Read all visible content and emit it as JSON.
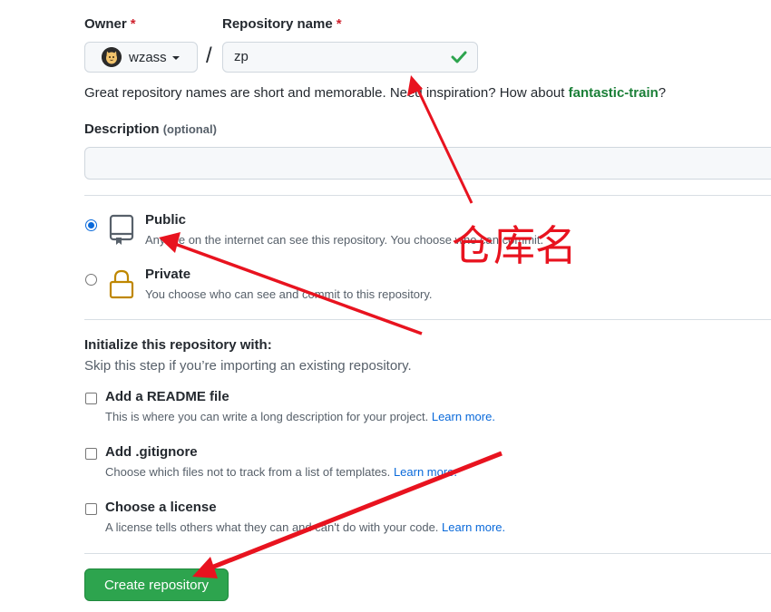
{
  "owner": {
    "label": "Owner",
    "required_mark": "*",
    "name": "wzass"
  },
  "repository": {
    "label": "Repository name",
    "required_mark": "*",
    "separator": "/",
    "value": "zp",
    "hint_prefix": "Great repository names are short and memorable. Need inspiration? How about ",
    "suggestion": "fantastic-train",
    "hint_suffix": "?"
  },
  "description": {
    "label": "Description",
    "optional": "(optional)",
    "value": ""
  },
  "visibility": {
    "options": [
      {
        "title": "Public",
        "subtitle": "Anyone on the internet can see this repository. You choose who can commit.",
        "selected": true,
        "icon": "repo-icon"
      },
      {
        "title": "Private",
        "subtitle": "You choose who can see and commit to this repository.",
        "selected": false,
        "icon": "lock-icon"
      }
    ]
  },
  "initialize": {
    "title": "Initialize this repository with:",
    "subtitle": "Skip this step if you’re importing an existing repository.",
    "items": [
      {
        "title": "Add a README file",
        "subtitle": "This is where you can write a long description for your project.",
        "link": "Learn more.",
        "checked": false
      },
      {
        "title": "Add .gitignore",
        "subtitle": "Choose which files not to track from a list of templates.",
        "link": "Learn more.",
        "checked": false
      },
      {
        "title": "Choose a license",
        "subtitle": "A license tells others what they can and can't do with your code.",
        "link": "Learn more.",
        "checked": false
      }
    ]
  },
  "create_button": "Create repository",
  "annotation": {
    "text": "仓库名",
    "color": "#e8131f"
  },
  "colors": {
    "accent": "#0969da",
    "success": "#2da44e",
    "suggestion": "#1a7f37",
    "required": "#cf222e"
  }
}
